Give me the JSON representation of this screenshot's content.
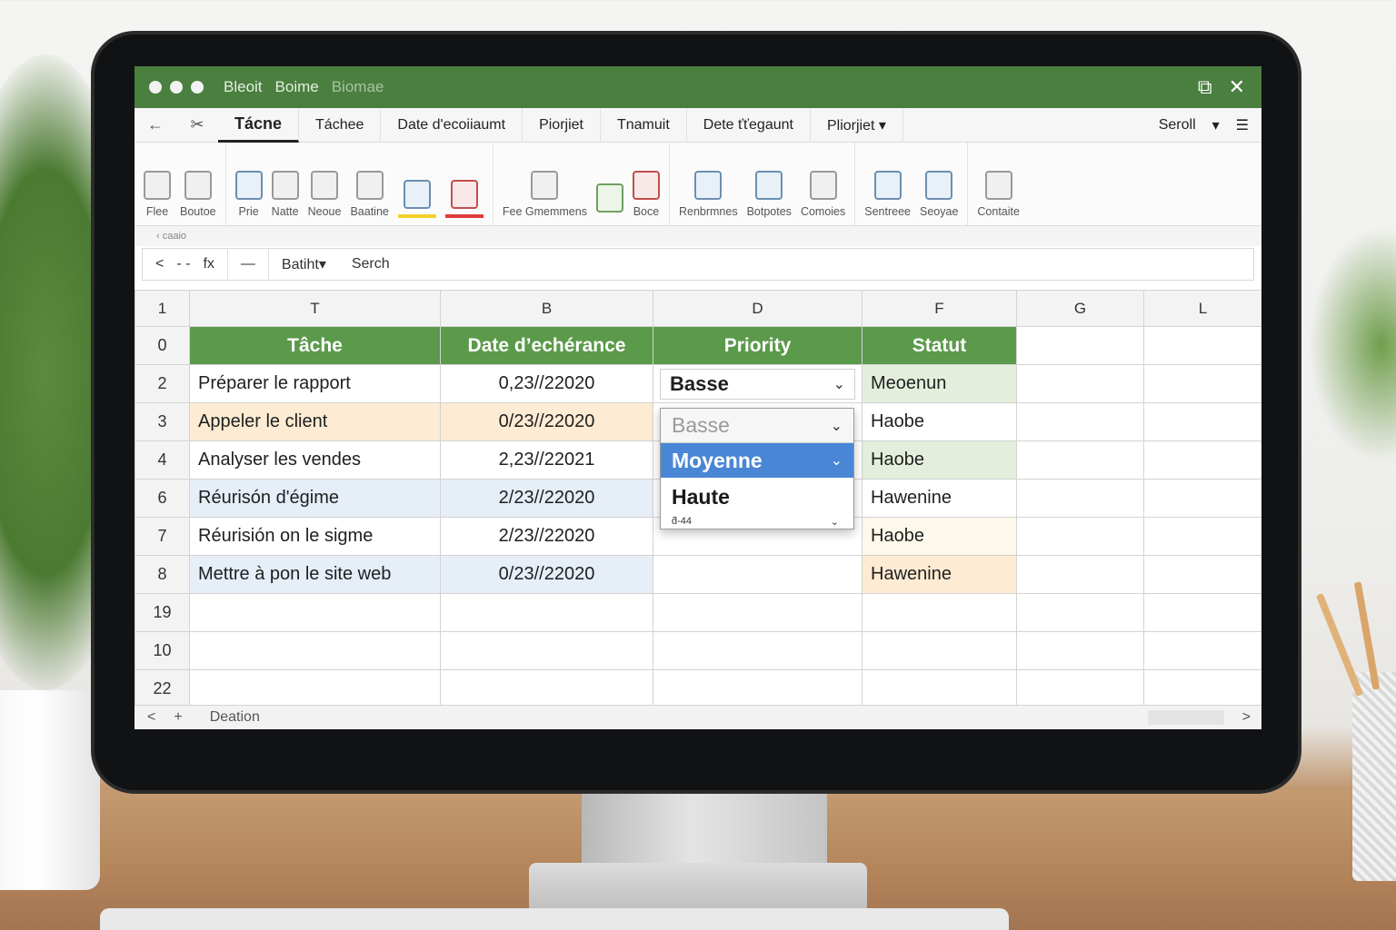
{
  "titlebar": {
    "crumbs": [
      "Bleoit",
      "Boime",
      "Biomae"
    ],
    "restore_glyph": "⧉",
    "close_glyph": "✕"
  },
  "tabs": {
    "back_glyph": "←",
    "pin_glyph": "✂",
    "items": [
      "Tácne",
      "Táchee",
      "Date d'ecoiiaumt",
      "Piorjiet",
      "Tnamuit",
      "Dete ťťegaunt",
      "Pliorjiet ▾"
    ],
    "scroll": "Seroll",
    "scroll_caret": "▾",
    "menu_glyph": "☰"
  },
  "ribbon": {
    "groups": [
      [
        "Flee",
        "Boutoe"
      ],
      [
        "Prie",
        "Natte",
        "Neoue",
        "Baatine",
        "",
        ""
      ],
      [
        "Fee Gmemmens",
        "",
        "Boce"
      ],
      [
        "Renbrmnes",
        "Botpotes",
        "Comoies"
      ],
      [
        "Sentreee",
        "Seoyae"
      ],
      [
        "Contaite"
      ]
    ]
  },
  "subbar": {
    "label": "‹ caaio"
  },
  "formula_bar": {
    "back": "<",
    "mid": "- -",
    "fx": "fx",
    "dash": "—",
    "name_box": "Batiht▾",
    "search": "Serch"
  },
  "columns": [
    "1",
    "T",
    "B",
    "D",
    "F",
    "G",
    "L"
  ],
  "header_row": {
    "row_number": "0",
    "task": "Tâche",
    "date": "Date d’echérance",
    "priority": "Priority",
    "status": "Statut"
  },
  "rows": [
    {
      "num": "2",
      "task": "Préparer le rapport",
      "date": "0,23//22020",
      "priority": "Basse",
      "status": "Meoenun"
    },
    {
      "num": "3",
      "task": "Appeler le client",
      "date": "0/23//22020",
      "priority": "",
      "status": "Haobe"
    },
    {
      "num": "4",
      "task": "Analyser les vendes",
      "date": "2,23//22021",
      "priority": "",
      "status": "Haobe"
    },
    {
      "num": "6",
      "task": "Réurisón d'égime",
      "date": "2/23//22020",
      "priority": "",
      "status": "Hawenine"
    },
    {
      "num": "7",
      "task": "Réurisión on le sigme",
      "date": "2/23//22020",
      "priority": "",
      "status": "Haobe"
    },
    {
      "num": "8",
      "task": "Mettre à pon le site web",
      "date": "0/23//22020",
      "priority": "",
      "status": "Hawenine"
    },
    {
      "num": "19",
      "task": "",
      "date": "",
      "priority": "",
      "status": ""
    },
    {
      "num": "10",
      "task": "",
      "date": "",
      "priority": "",
      "status": ""
    },
    {
      "num": "22",
      "task": "",
      "date": "",
      "priority": "",
      "status": ""
    }
  ],
  "dropdown": {
    "current": "Basse",
    "options": [
      "Moyenne",
      "Haute"
    ],
    "footer": "ƌ-44",
    "chevron": "⌄"
  },
  "bottombar": {
    "prev": "<",
    "add": "+",
    "sheet": "Deation",
    "next": ">"
  },
  "colors": {
    "titlebar": "#4a7f3f",
    "header_fill": "#5b9a4b",
    "dropdown_highlight": "#4a86d6"
  }
}
